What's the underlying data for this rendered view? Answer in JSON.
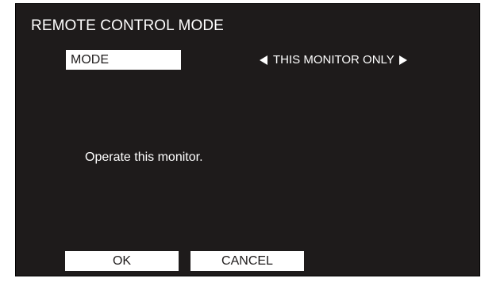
{
  "dialog": {
    "title": "REMOTE CONTROL MODE",
    "setting_label": "MODE",
    "setting_value": "THIS MONITOR ONLY",
    "message": "Operate this monitor.",
    "ok_label": "OK",
    "cancel_label": "CANCEL"
  },
  "icons": {
    "left": "left-triangle-arrow",
    "right": "right-triangle-arrow"
  },
  "colors": {
    "panel_background": "#1e1b1b",
    "text": "#ffffff",
    "highlight": "#ffffff",
    "highlight_text": "#1e1b1b"
  }
}
